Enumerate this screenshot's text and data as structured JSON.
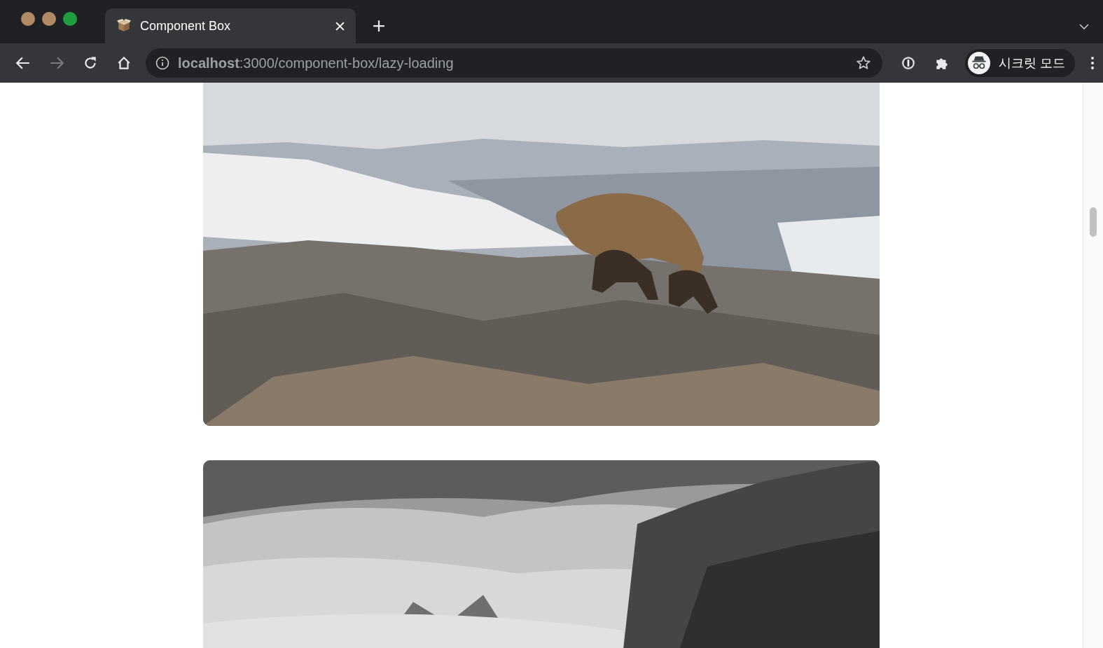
{
  "tabs": [
    {
      "title": "Component Box",
      "selected": true
    }
  ],
  "toolbar": {
    "url": "**localhost**:3000/component-box/lazy-loading",
    "back_disabled": false,
    "forward_disabled": true,
    "profile_label": "시크릿 모드"
  }
}
